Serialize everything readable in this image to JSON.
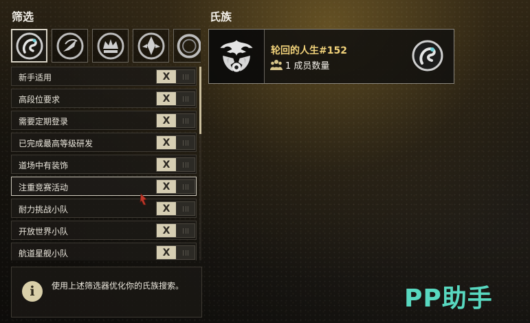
{
  "filter_panel": {
    "title": "筛选",
    "emblem_tabs": [
      {
        "icon": "emblem-swirl-icon",
        "selected": true
      },
      {
        "icon": "emblem-blade-icon",
        "selected": false
      },
      {
        "icon": "emblem-crown-icon",
        "selected": false
      },
      {
        "icon": "emblem-horned-icon",
        "selected": false
      },
      {
        "icon": "emblem-ring-icon",
        "selected": false
      }
    ],
    "filters": [
      {
        "label": "新手适用",
        "toggle": "X"
      },
      {
        "label": "高段位要求",
        "toggle": "X"
      },
      {
        "label": "需要定期登录",
        "toggle": "X"
      },
      {
        "label": "已完成最高等级研发",
        "toggle": "X"
      },
      {
        "label": "道场中有装饰",
        "toggle": "X"
      },
      {
        "label": "注重竞赛活动",
        "toggle": "X"
      },
      {
        "label": "耐力挑战小队",
        "toggle": "X"
      },
      {
        "label": "开放世界小队",
        "toggle": "X"
      },
      {
        "label": "航道星舰小队",
        "toggle": "X"
      }
    ],
    "info_text": "使用上述筛选器优化你的氏族搜索。"
  },
  "clan_panel": {
    "title": "氏族",
    "clan": {
      "name": "轮回的人生#152",
      "member_count": "1 成员数量"
    }
  },
  "watermark": "PP助手",
  "colors": {
    "toggle_active": "#d6ceb3",
    "clan_name": "#f1d27a",
    "watermark": "#58d8c0"
  }
}
